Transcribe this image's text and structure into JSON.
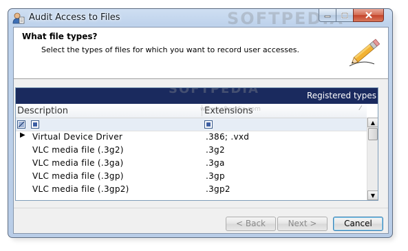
{
  "window": {
    "title": "Audit Access to Files",
    "controls": {
      "minimize_icon": "minimize-icon",
      "maximize_icon": "maximize-icon",
      "close_icon": "close-icon"
    }
  },
  "header": {
    "title": "What file types?",
    "subtitle": "Select the types of files for which you want to record user accesses.",
    "icon": "pencil-icon"
  },
  "table": {
    "banner": "Registered types",
    "columns": [
      "Description",
      "Extensions"
    ],
    "rows": [
      {
        "description": "Virtual Device Driver",
        "extensions": ".386; .vxd",
        "current": true
      },
      {
        "description": "VLC media file (.3g2)",
        "extensions": ".3g2"
      },
      {
        "description": "VLC media file (.3ga)",
        "extensions": ".3ga"
      },
      {
        "description": "VLC media file (.3gp)",
        "extensions": ".3gp"
      },
      {
        "description": "VLC media file (.3gp2)",
        "extensions": ".3gp2"
      }
    ]
  },
  "buttons": {
    "back": "< Back",
    "next": "Next >",
    "cancel": "Cancel"
  },
  "watermarks": {
    "top": "SOFTPEDIA",
    "middle": "SOFTPEDIA",
    "url": "www.softpedia.com"
  },
  "colors": {
    "banner_bg": "#1a2a5e",
    "close_red": "#c4432a",
    "default_button_border": "#3c7fb1"
  }
}
